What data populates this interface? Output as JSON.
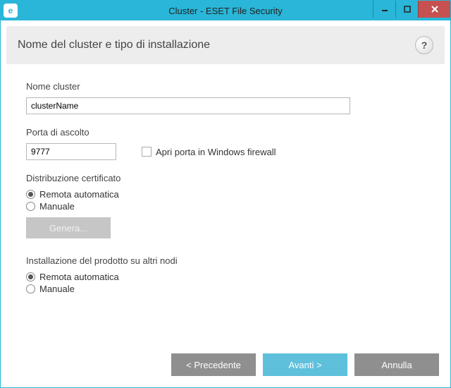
{
  "titlebar": {
    "icon_letter": "e",
    "title": "Cluster - ESET File Security"
  },
  "banner": {
    "title": "Nome del cluster e tipo di installazione",
    "help_symbol": "?"
  },
  "fields": {
    "cluster_name": {
      "label": "Nome cluster",
      "value": "clusterName"
    },
    "listen_port": {
      "label": "Porta di ascolto",
      "value": "9777"
    },
    "firewall_checkbox": {
      "label": "Apri porta in Windows firewall",
      "checked": false
    },
    "cert_dist": {
      "label": "Distribuzione certificato",
      "options": {
        "auto": "Remota automatica",
        "manual": "Manuale"
      },
      "selected": "auto",
      "generate_button": "Genera..."
    },
    "product_install": {
      "label": "Installazione del prodotto su altri nodi",
      "options": {
        "auto": "Remota automatica",
        "manual": "Manuale"
      },
      "selected": "auto"
    }
  },
  "footer": {
    "back": "<  Precedente",
    "next": "Avanti  >",
    "cancel": "Annulla"
  }
}
